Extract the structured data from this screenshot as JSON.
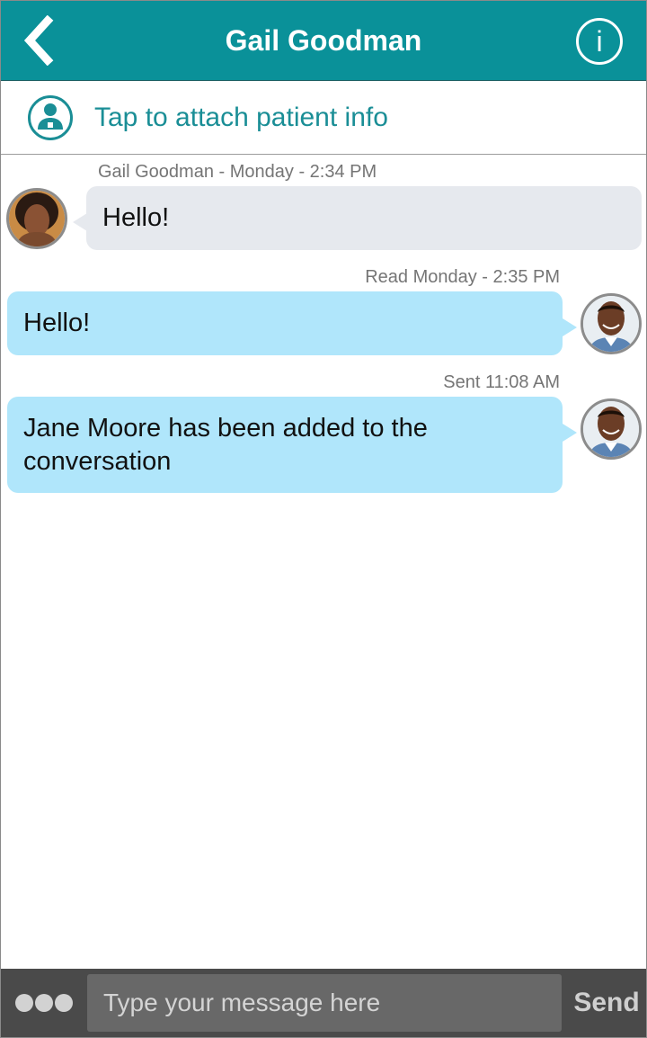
{
  "header": {
    "title": "Gail Goodman",
    "back_icon": "chevron-left-icon",
    "info_icon": "info-icon",
    "info_glyph": "i",
    "color": "#0a9199"
  },
  "attach": {
    "label": "Tap to attach patient info",
    "icon": "patient-icon",
    "color": "#1a8e96"
  },
  "messages": [
    {
      "direction": "incoming",
      "meta": "Gail Goodman - Monday - 2:34 PM",
      "text": "Hello!"
    },
    {
      "direction": "outgoing",
      "meta": "Read  Monday - 2:35 PM",
      "text": "Hello!"
    },
    {
      "direction": "outgoing",
      "meta": "Sent  11:08 AM",
      "text_lines": [
        "Jane Moore has been added to the",
        "conversation"
      ]
    }
  ],
  "composer": {
    "placeholder": "Type your message here",
    "value": "",
    "send_label": "Send",
    "more_icon": "more-dots-icon"
  },
  "colors": {
    "incoming_bubble": "#e6e9ee",
    "outgoing_bubble": "#b0e6fb",
    "composer_bar": "#4a4a4a"
  }
}
